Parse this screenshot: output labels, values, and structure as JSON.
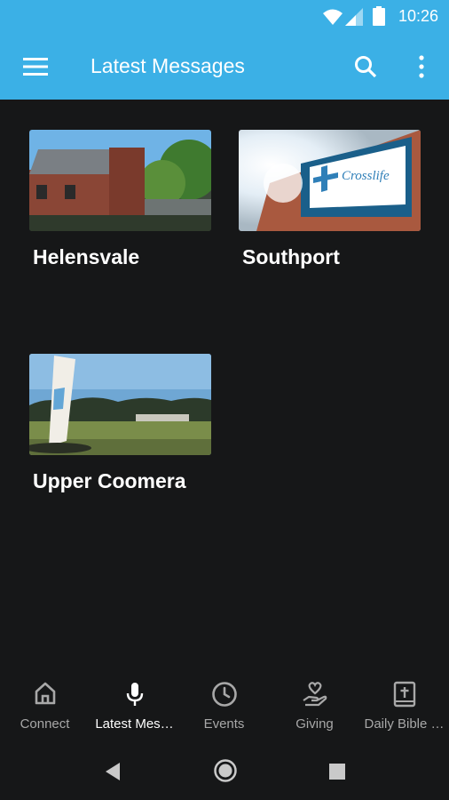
{
  "status_bar": {
    "time": "10:26",
    "icons": [
      "wifi-icon",
      "signal-icon",
      "battery-icon"
    ]
  },
  "app_bar": {
    "title": "Latest Messages",
    "icons": [
      "menu-icon",
      "search-icon",
      "more-vert-icon"
    ],
    "color": "#3bb0e6"
  },
  "locations": [
    {
      "name": "Helensvale"
    },
    {
      "name": "Southport"
    },
    {
      "name": "Upper Coomera"
    }
  ],
  "bottom_nav": {
    "items": [
      {
        "label": "Connect",
        "icon": "home-icon"
      },
      {
        "label": "Latest Mes…",
        "icon": "microphone-icon",
        "active": true
      },
      {
        "label": "Events",
        "icon": "clock-icon"
      },
      {
        "label": "Giving",
        "icon": "giving-hand-heart-icon"
      },
      {
        "label": "Daily Bible …",
        "icon": "bible-icon"
      }
    ]
  },
  "system_nav": {
    "icons": [
      "back-icon",
      "home-circle-icon",
      "recents-icon"
    ]
  },
  "colors": {
    "background": "#161718",
    "accent": "#3bb0e6",
    "text": "#ffffff",
    "inactive": "#a8a8a8"
  }
}
